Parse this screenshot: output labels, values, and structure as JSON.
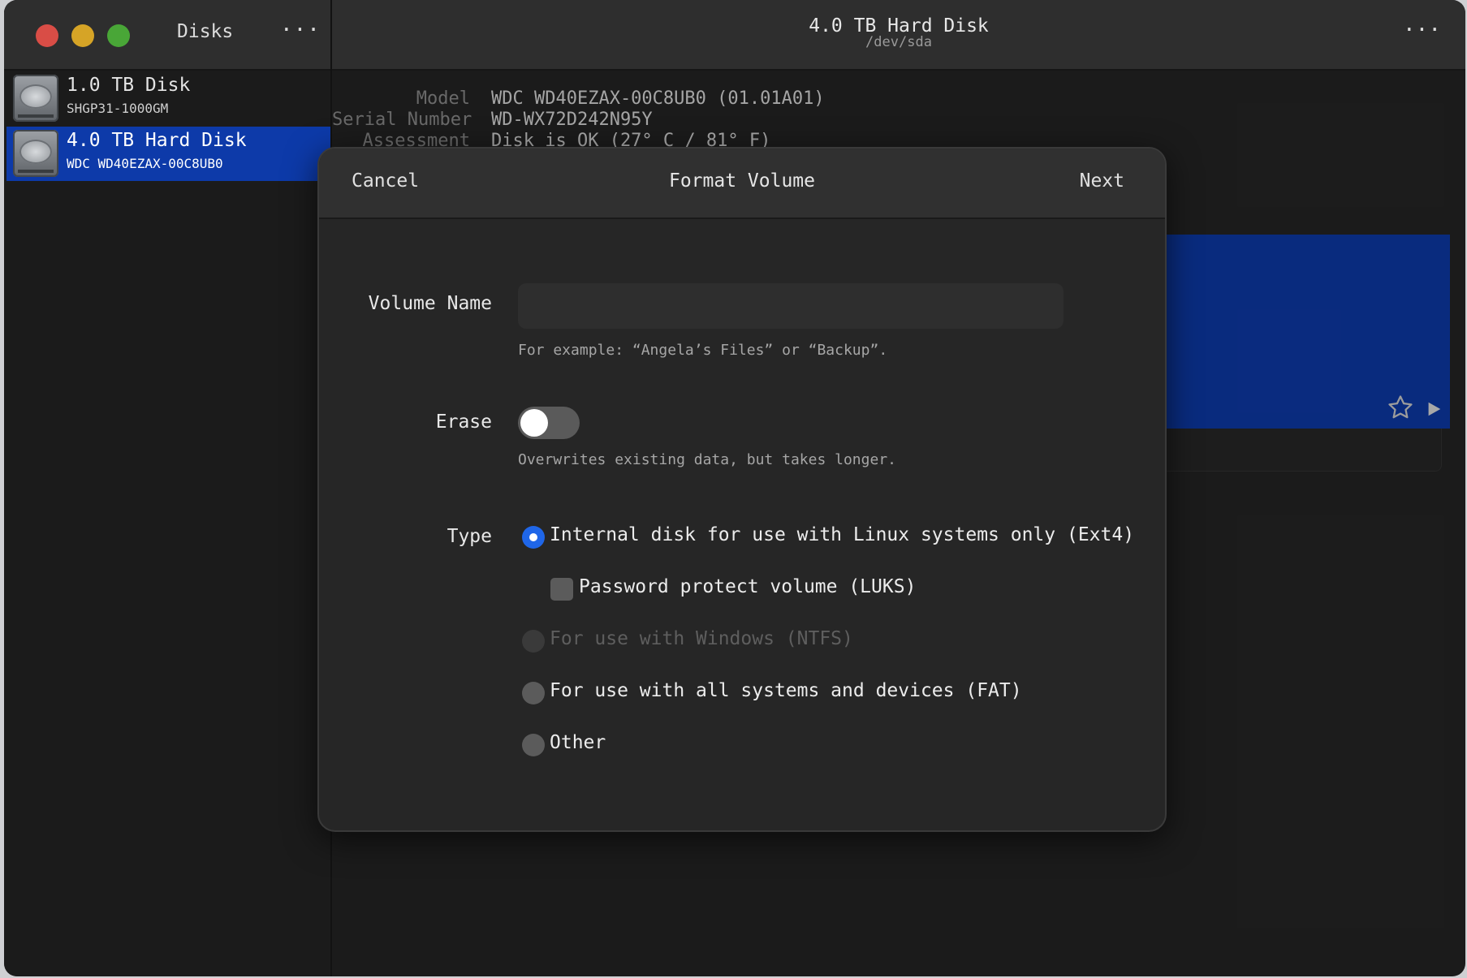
{
  "sidebar": {
    "title": "Disks",
    "menu_glyph": "···",
    "disks": [
      {
        "name": "1.0 TB Disk",
        "subtitle": "SHGP31-1000GM",
        "selected": false
      },
      {
        "name": "4.0 TB Hard Disk",
        "subtitle": "WDC WD40EZAX-00C8UB0",
        "selected": true
      }
    ]
  },
  "header": {
    "title": "4.0 TB Hard Disk",
    "subtitle": "/dev/sda",
    "menu_glyph": "···"
  },
  "details": {
    "model_label": "Model",
    "model_value": "WDC WD40EZAX-00C8UB0 (01.01A01)",
    "serial_label": "Serial Number",
    "serial_value": "WD-WX72D242N95Y",
    "assessment_label": "Assessment",
    "assessment_value": "Disk is OK (27° C / 81° F)"
  },
  "dialog": {
    "cancel_label": "Cancel",
    "title": "Format Volume",
    "next_label": "Next",
    "volume_name_label": "Volume Name",
    "volume_name_value": "",
    "volume_name_hint": "For example: “Angela’s Files” or “Backup”.",
    "erase_label": "Erase",
    "erase_enabled": false,
    "erase_hint": "Overwrites existing data, but takes longer.",
    "type_label": "Type",
    "options": {
      "ext4": "Internal disk for use with Linux systems only (Ext4)",
      "luks": "Password protect volume (LUKS)",
      "ntfs": "For use with Windows (NTFS)",
      "fat": "For use with all systems and devices (FAT)",
      "other": "Other"
    },
    "selected_type": "ext4"
  },
  "colors": {
    "accent": "#1f66e8",
    "selection": "#0d3aa9",
    "close": "#d94d46",
    "minimize": "#d6a426",
    "maximize": "#49a637"
  },
  "icons": [
    "close-icon",
    "minimize-icon",
    "maximize-icon",
    "more-icon",
    "hard-disk-icon",
    "star-icon",
    "play-icon"
  ]
}
